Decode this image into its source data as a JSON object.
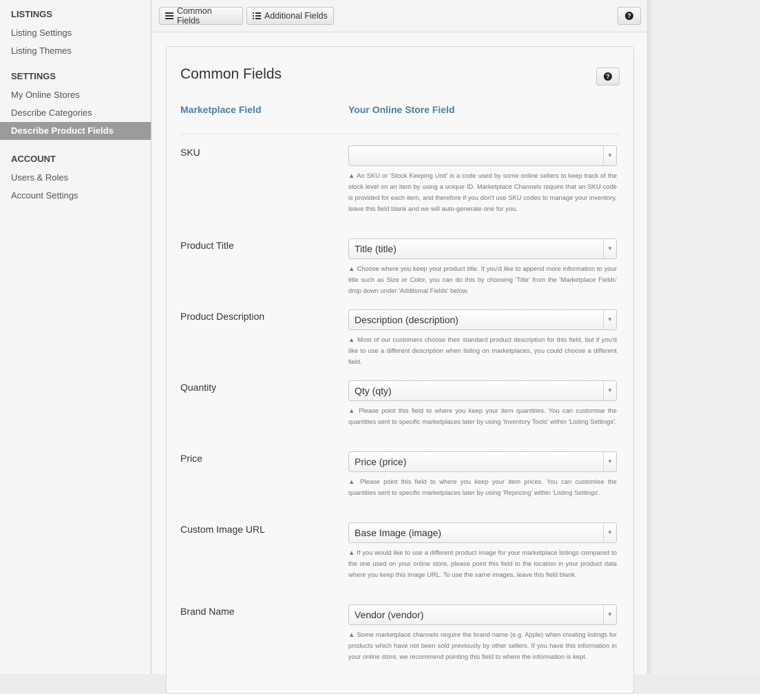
{
  "sidebar": {
    "sections": [
      {
        "heading": "LISTINGS",
        "items": [
          "Listing Settings",
          "Listing Themes"
        ]
      },
      {
        "heading": "SETTINGS",
        "items": [
          "My Online Stores",
          "Describe Categories",
          "Describe Product Fields"
        ]
      },
      {
        "heading": "ACCOUNT",
        "items": [
          "Users & Roles",
          "Account Settings"
        ]
      }
    ],
    "active_item": "Describe Product Fields"
  },
  "toolbar": {
    "common_fields_label": "Common Fields",
    "additional_fields_label": "Additional Fields",
    "help_symbol": "?"
  },
  "panel": {
    "title": "Common Fields",
    "help_symbol": "?",
    "col_marketplace": "Marketplace Field",
    "col_store": "Your Online Store Field",
    "fields": [
      {
        "label": "SKU",
        "value": "",
        "help": "▲ An SKU or 'Stock Keeping Unit' is a code used by some online sellers to keep track of the stock level on an item by using a unique ID. Marketplace Channels require that an SKU code is provided for each item, and therefore if you don't use SKU codes to manage your inventory, leave this field blank and we will auto-generate one for you."
      },
      {
        "label": "Product Title",
        "value": "Title (title)",
        "help": "▲ Choose where you keep your product title. If you'd like to append more information to your title such as Size or Color, you can do this by choosing 'Title' from the 'Marketplace Fields' drop down under 'Additional Fields' below."
      },
      {
        "label": "Product Description",
        "value": "Description (description)",
        "help": "▲ Most of our customers choose their standard product description for this field, but if you'd like to use a different description when listing on marketplaces, you could choose a different field."
      },
      {
        "label": "Quantity",
        "value": "Qty (qty)",
        "help": "▲ Please point this field to where you keep your item quantities. You can customise the quantities sent to specific marketplaces later by using 'Inventory Tools' within 'Listing Settings'."
      },
      {
        "label": "Price",
        "value": "Price (price)",
        "help": "▲ Please point this field to where you keep your item prices. You can customise the quantities sent to specific marketplaces later by using 'Repricing' within 'Listing Settings'."
      },
      {
        "label": "Custom Image URL",
        "value": "Base Image (image)",
        "help": "▲ If you would like to use a different product image for your marketplace listings compared to the one used on your online store, please point this field to the location in your product data where you keep this image URL. To use the same images, leave this field blank."
      },
      {
        "label": "Brand Name",
        "value": "Vendor (vendor)",
        "help": "▲ Some marketplace channels require the brand name (e.g. Apple) when creating listings for products which have not been sold previously by other sellers. If you have this information in your online store, we recommend pointing this field to where the information is kept."
      }
    ]
  },
  "colors": {
    "accent": "#4a7fa6",
    "active_nav": "#9b9b9b"
  }
}
